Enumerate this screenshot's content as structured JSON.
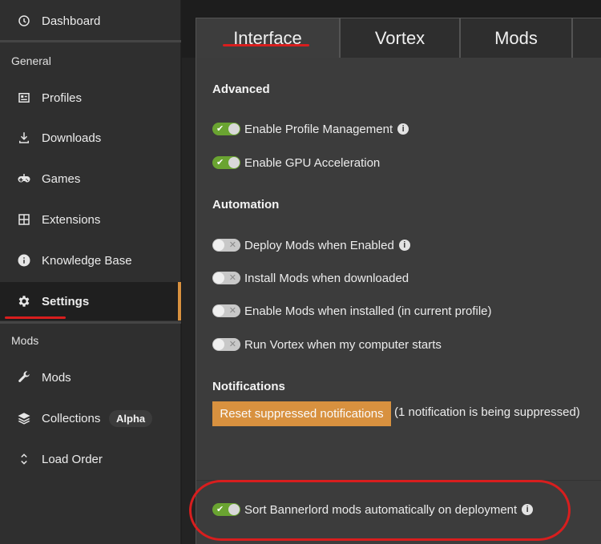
{
  "sidebar": {
    "dashboard": "Dashboard",
    "section_general": "General",
    "general_items": [
      {
        "label": "Profiles",
        "icon": "profiles-icon"
      },
      {
        "label": "Downloads",
        "icon": "download-icon"
      },
      {
        "label": "Games",
        "icon": "gamepad-icon"
      },
      {
        "label": "Extensions",
        "icon": "extensions-icon"
      },
      {
        "label": "Knowledge Base",
        "icon": "info-icon"
      },
      {
        "label": "Settings",
        "icon": "gear-icon"
      }
    ],
    "section_mods": "Mods",
    "mods_items": [
      {
        "label": "Mods",
        "icon": "wrench-icon"
      },
      {
        "label": "Collections",
        "icon": "layers-icon",
        "badge": "Alpha"
      },
      {
        "label": "Load Order",
        "icon": "sort-icon"
      }
    ],
    "active_item": "Settings"
  },
  "tabs": [
    {
      "label": "Interface",
      "active": true
    },
    {
      "label": "Vortex",
      "active": false
    },
    {
      "label": "Mods",
      "active": false
    }
  ],
  "settings": {
    "advanced": {
      "heading": "Advanced",
      "items": [
        {
          "label": "Enable Profile Management",
          "on": true,
          "info": true
        },
        {
          "label": "Enable GPU Acceleration",
          "on": true,
          "info": false
        }
      ]
    },
    "automation": {
      "heading": "Automation",
      "items": [
        {
          "label": "Deploy Mods when Enabled",
          "on": false,
          "info": true
        },
        {
          "label": "Install Mods when downloaded",
          "on": false,
          "info": false
        },
        {
          "label": "Enable Mods when installed (in current profile)",
          "on": false,
          "info": false
        },
        {
          "label": "Run Vortex when my computer starts",
          "on": false,
          "info": false
        }
      ]
    },
    "notifications": {
      "heading": "Notifications",
      "reset_button": "Reset suppressed notifications",
      "note": "(1 notification is being suppressed)"
    },
    "bannerlord": {
      "label": "Sort Bannerlord mods automatically on deployment",
      "on": true,
      "info": true
    }
  },
  "colors": {
    "accent": "#d8913f",
    "toggle_on": "#6aa431",
    "annotation_red": "#d81e1e"
  }
}
